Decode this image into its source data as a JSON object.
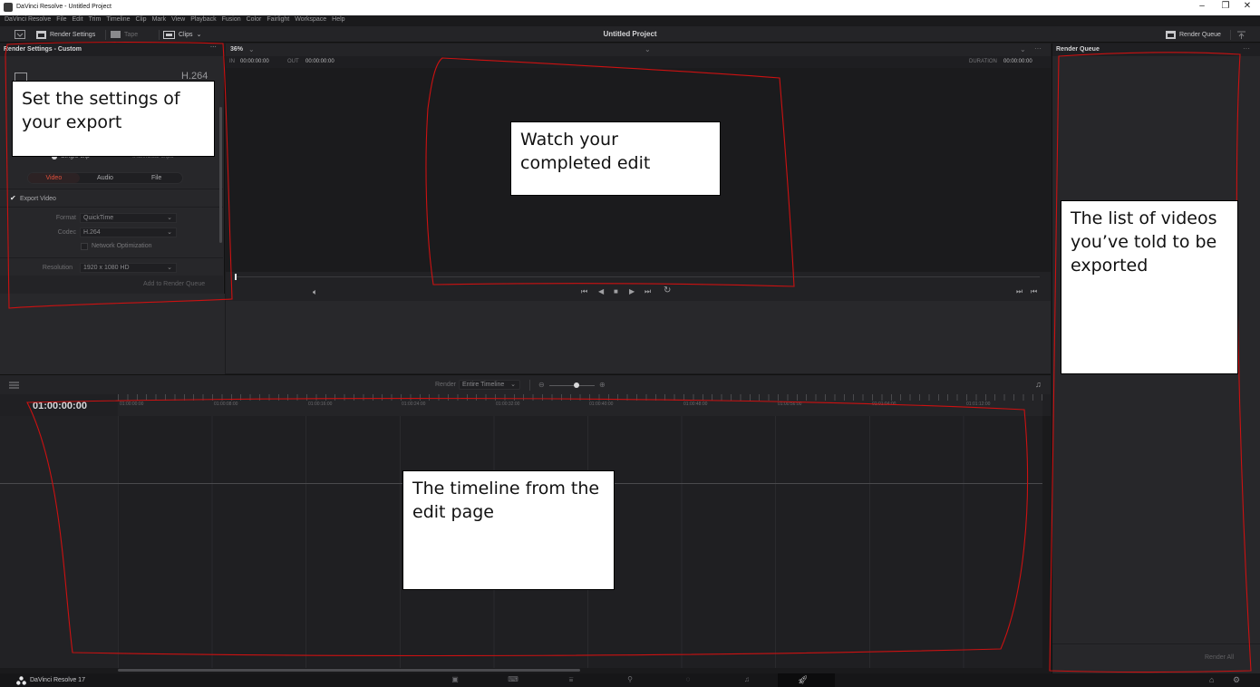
{
  "window": {
    "title": "DaVinci Resolve - Untitled Project",
    "controls": [
      "–",
      "❐",
      "✕"
    ]
  },
  "menu": [
    "DaVinci Resolve",
    "File",
    "Edit",
    "Trim",
    "Timeline",
    "Clip",
    "Mark",
    "View",
    "Playback",
    "Fusion",
    "Color",
    "Fairlight",
    "Workspace",
    "Help"
  ],
  "toolbar": {
    "render_settings": "Render Settings",
    "tape": "Tape",
    "clips": "Clips",
    "project_title": "Untitled Project",
    "render_queue": "Render Queue"
  },
  "render_settings": {
    "header": "Render Settings - Custom",
    "presets": [
      "H.264"
    ],
    "render_mode": [
      "Single clip",
      "Individual clips"
    ],
    "tabs": [
      "Video",
      "Audio",
      "File"
    ],
    "export_video": "Export Video",
    "format_label": "Format",
    "format_value": "QuickTime",
    "codec_label": "Codec",
    "codec_value": "H.264",
    "network_optimization": "Network Optimization",
    "resolution_label": "Resolution",
    "resolution_value": "1920 x 1080 HD",
    "add_button": "Add to Render Queue"
  },
  "viewer": {
    "zoom": "36%",
    "in_label": "IN",
    "in_tc": "00:00:00:00",
    "out_label": "OUT",
    "out_tc": "00:00:00:00",
    "duration_label": "DURATION",
    "duration_tc": "00:00:00:00"
  },
  "render_queue": {
    "header": "Render Queue",
    "render_all": "Render All"
  },
  "timeline": {
    "render_label": "Render",
    "render_scope": "Entire Timeline",
    "timecode": "01:00:00:00",
    "ruler": [
      "01:00:00:00",
      "01:00:08:00",
      "01:00:16:00",
      "01:00:24:00",
      "01:00:32:00",
      "01:00:40:00",
      "01:00:48:00",
      "01:00:56:00",
      "01:01:04:00",
      "01:01:12:00"
    ]
  },
  "bottom": {
    "app_name": "DaVinci Resolve 17"
  },
  "annotations": {
    "settings": "Set the settings of your export",
    "viewer": "Watch your completed edit",
    "queue": "The list of videos you’ve told to be exported",
    "timeline": "The timeline from the edit page"
  },
  "colors": {
    "accent": "#e0503c",
    "annotation_line": "#cc1111",
    "panel": "#27272a"
  }
}
